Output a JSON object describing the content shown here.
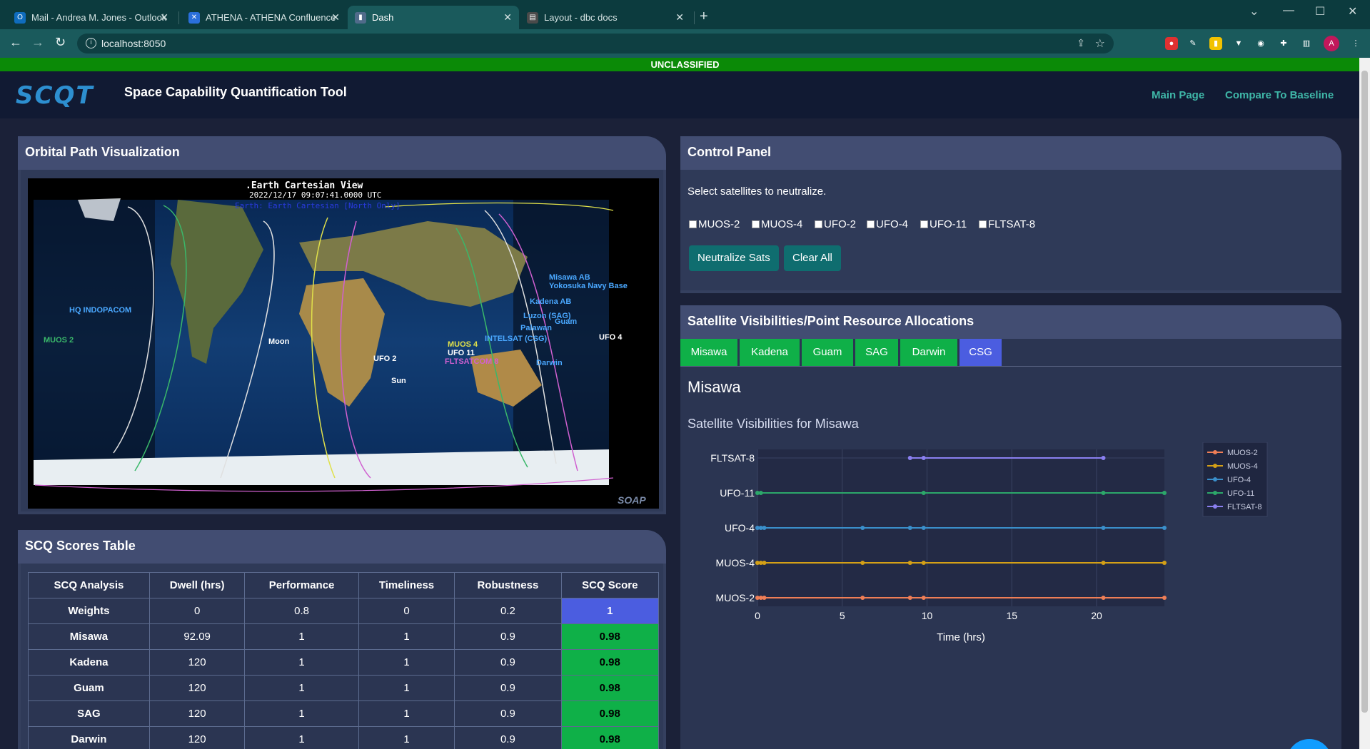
{
  "browser": {
    "tabs": [
      {
        "title": "Mail - Andrea M. Jones - Outlook",
        "icon": "outlook-icon"
      },
      {
        "title": "ATHENA - ATHENA Confluence",
        "icon": "confluence-icon"
      },
      {
        "title": "Dash",
        "icon": "chart-icon"
      },
      {
        "title": "Layout - dbc docs",
        "icon": "docs-icon"
      }
    ],
    "url": "localhost:8050",
    "profile_initial": "A"
  },
  "classification": "UNCLASSIFIED",
  "app": {
    "logo": "SCQT",
    "title": "Space Capability Quantification Tool",
    "nav": [
      "Main Page",
      "Compare To Baseline"
    ]
  },
  "orbital": {
    "heading": "Orbital Path Visualization",
    "view_title": ".Earth Cartesian View",
    "timestamp": "2022/12/17 09:07:41.0000 UTC",
    "subtitle": "Earth: Earth Cartesian [North Only]",
    "watermark": "SOAP",
    "labels": [
      "HQ INDOPACOM",
      "MUOS 2",
      "Moon",
      "UFO 2",
      "Sun",
      "MUOS 4",
      "UFO 11",
      "FLTSATCOM 8",
      "INTELSAT (CSG)",
      "Misawa AB",
      "Yokosuka Navy Base",
      "Kadena AB",
      "Luzon (SAG)",
      "Guam",
      "Palawan",
      "Darwin",
      "UFO 4"
    ]
  },
  "control_panel": {
    "heading": "Control Panel",
    "prompt": "Select satellites to neutralize.",
    "satellites": [
      "MUOS-2",
      "MUOS-4",
      "UFO-2",
      "UFO-4",
      "UFO-11",
      "FLTSAT-8"
    ],
    "neutralize_label": "Neutralize Sats",
    "clear_label": "Clear All"
  },
  "allocations": {
    "heading": "Satellite Visibilities/Point Resource Allocations",
    "tabs": [
      "Misawa",
      "Kadena",
      "Guam",
      "SAG",
      "Darwin",
      "CSG"
    ],
    "active_tab": "CSG",
    "location": "Misawa",
    "chart_title": "Satellite Visibilities for Misawa"
  },
  "chart_data": {
    "type": "line",
    "xlabel": "Time (hrs)",
    "ylabel": "",
    "xlim": [
      0,
      24
    ],
    "xticks": [
      0,
      5,
      10,
      15,
      20
    ],
    "categories": [
      "MUOS-2",
      "MUOS-4",
      "UFO-4",
      "UFO-11",
      "FLTSAT-8"
    ],
    "legend_position": "top-right",
    "series": [
      {
        "name": "MUOS-2",
        "color": "#ef7e56",
        "x": [
          0,
          0.2,
          0.4,
          6.2,
          9,
          9.8,
          20.4,
          24
        ]
      },
      {
        "name": "MUOS-4",
        "color": "#d4a017",
        "x": [
          0,
          0.2,
          0.4,
          6.2,
          9,
          9.8,
          20.4,
          24
        ]
      },
      {
        "name": "UFO-4",
        "color": "#3a8fcb",
        "x": [
          0,
          0.2,
          0.4,
          6.2,
          9,
          9.8,
          20.4,
          24
        ]
      },
      {
        "name": "UFO-11",
        "color": "#2ca86a",
        "x": [
          0,
          0.2,
          9.8,
          20.4,
          24
        ]
      },
      {
        "name": "FLTSAT-8",
        "color": "#8a7ff0",
        "x": [
          9,
          9.8,
          20.4
        ]
      }
    ]
  },
  "scores": {
    "heading": "SCQ Scores Table",
    "columns": [
      "SCQ Analysis",
      "Dwell (hrs)",
      "Performance",
      "Timeliness",
      "Robustness",
      "SCQ Score"
    ],
    "rows": [
      [
        "Weights",
        "0",
        "0.8",
        "0",
        "0.2",
        "1"
      ],
      [
        "Misawa",
        "92.09",
        "1",
        "1",
        "0.9",
        "0.98"
      ],
      [
        "Kadena",
        "120",
        "1",
        "1",
        "0.9",
        "0.98"
      ],
      [
        "Guam",
        "120",
        "1",
        "1",
        "0.9",
        "0.98"
      ],
      [
        "SAG",
        "120",
        "1",
        "1",
        "0.9",
        "0.98"
      ],
      [
        "Darwin",
        "120",
        "1",
        "1",
        "0.9",
        "0.98"
      ]
    ]
  }
}
